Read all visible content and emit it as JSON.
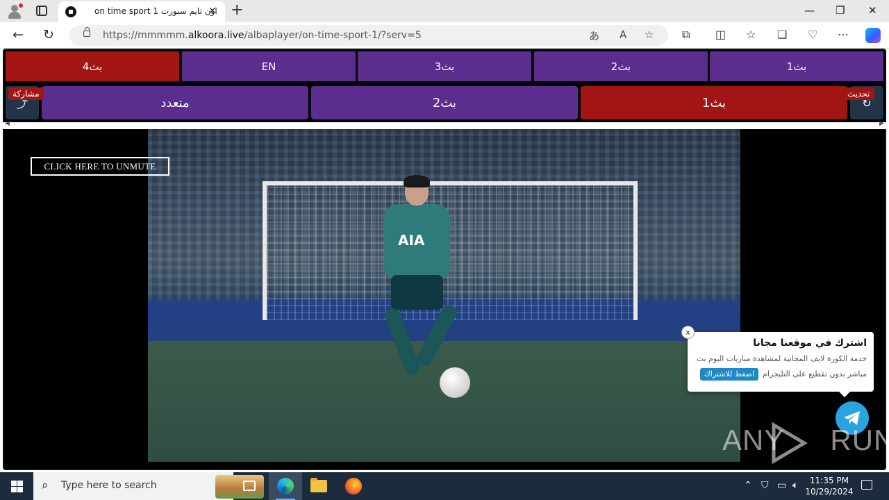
{
  "browser": {
    "tab_title": "on time sport 1 اون تايم سبورت",
    "tab_close": "✕",
    "new_tab": "+",
    "url_prefix": "https://mmmmm.",
    "url_domain": "alkoora.live",
    "url_path": "/albaplayer/on-time-sport-1/?serv=5",
    "window_controls": {
      "minimize": "—",
      "maximize": "❐",
      "close": "✕"
    }
  },
  "servers": [
    {
      "label": "بث4",
      "active": true
    },
    {
      "label": "EN",
      "active": false
    },
    {
      "label": "بث3",
      "active": false
    },
    {
      "label": "بث2",
      "active": false
    },
    {
      "label": "بث1",
      "active": false
    }
  ],
  "modes": [
    {
      "label": "متعدد",
      "active": false
    },
    {
      "label": "بث2",
      "active": false
    },
    {
      "label": "بث1",
      "active": true
    }
  ],
  "share_label": "مشاركة",
  "refresh_label": "تحديث",
  "player": {
    "unmute_label": "CLICK HERE TO UNMUTE",
    "sponsor": "AIA"
  },
  "popup": {
    "close": "x",
    "title": "اشترك في موقعنا مجانا",
    "line1": "خدمة الكورة لايف المجانية لمشاهدة مباريات اليوم بث",
    "line2": "مباشر بدون تقطيع على التليجرام",
    "cta": "اضغط للاشتراك"
  },
  "watermark": {
    "left": "ANY",
    "right": "RUN"
  },
  "taskbar": {
    "search_placeholder": "Type here to search",
    "time": "11:35 PM",
    "date": "10/29/2024"
  },
  "colors": {
    "server_button": "#5b2d8e",
    "active_button": "#a31515",
    "telegram": "#2aa3e0"
  }
}
